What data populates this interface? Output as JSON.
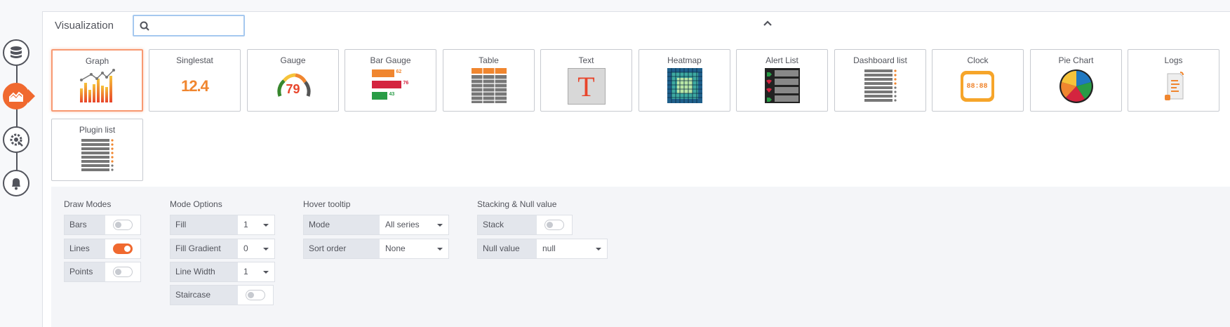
{
  "header": {
    "title": "Visualization",
    "search_value": ""
  },
  "rail": {
    "items": [
      "database-icon",
      "chart-icon",
      "settings-icon",
      "bell-icon"
    ],
    "active_index": 1
  },
  "visualizations": [
    {
      "label": "Graph",
      "selected": true
    },
    {
      "label": "Singlestat",
      "sample": "12.4"
    },
    {
      "label": "Gauge",
      "sample": "79"
    },
    {
      "label": "Bar Gauge",
      "values": [
        "62",
        "76",
        "43"
      ]
    },
    {
      "label": "Table"
    },
    {
      "label": "Text",
      "sample": "T"
    },
    {
      "label": "Heatmap"
    },
    {
      "label": "Alert List"
    },
    {
      "label": "Dashboard list"
    },
    {
      "label": "Clock",
      "sample": "88:88"
    },
    {
      "label": "Pie Chart"
    },
    {
      "label": "Logs"
    },
    {
      "label": "Plugin list"
    }
  ],
  "options": {
    "draw_modes": {
      "title": "Draw Modes",
      "items": [
        {
          "label": "Bars",
          "on": false
        },
        {
          "label": "Lines",
          "on": true
        },
        {
          "label": "Points",
          "on": false
        }
      ]
    },
    "mode_options": {
      "title": "Mode Options",
      "items": [
        {
          "label": "Fill",
          "value": "1"
        },
        {
          "label": "Fill Gradient",
          "value": "0"
        },
        {
          "label": "Line Width",
          "value": "1"
        },
        {
          "label": "Staircase",
          "toggle": false
        }
      ]
    },
    "hover_tooltip": {
      "title": "Hover tooltip",
      "items": [
        {
          "label": "Mode",
          "value": "All series"
        },
        {
          "label": "Sort order",
          "value": "None"
        }
      ]
    },
    "stacking": {
      "title": "Stacking & Null value",
      "items": [
        {
          "label": "Stack",
          "toggle": false
        },
        {
          "label": "Null value",
          "value": "null"
        }
      ]
    }
  },
  "colors": {
    "accent": "#f0692f",
    "rail": "#52545c",
    "panel_bg": "#f4f5f8"
  }
}
